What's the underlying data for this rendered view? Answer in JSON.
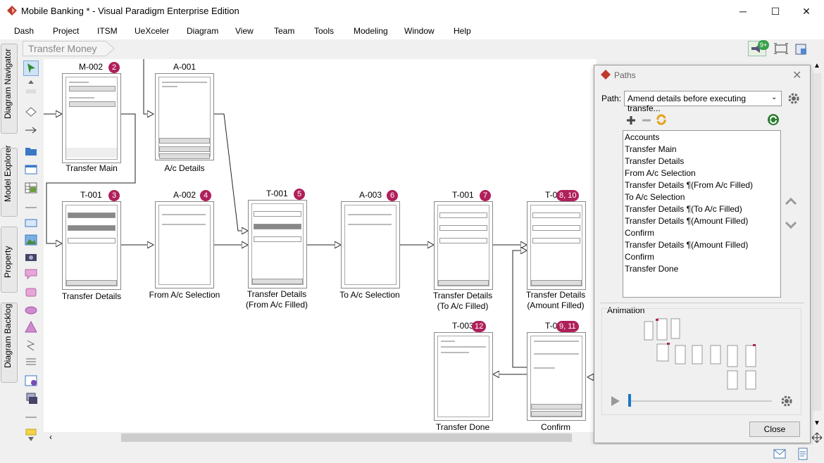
{
  "window": {
    "title": "Mobile Banking * - Visual Paradigm Enterprise Edition",
    "minimize_glyph": "─",
    "maximize_glyph": "☐",
    "close_glyph": "✕"
  },
  "menu": [
    "Dash",
    "Project",
    "ITSM",
    "UeXceler",
    "Diagram",
    "View",
    "Team",
    "Tools",
    "Modeling",
    "Window",
    "Help"
  ],
  "breadcrumb": "Transfer Money",
  "toolbar": {
    "notification_badge": "9+"
  },
  "left_tabs": [
    "Diagram Navigator",
    "Model Explorer",
    "Property",
    "Diagram Backlog"
  ],
  "screens": [
    {
      "id": "M-002",
      "badge": "2",
      "caption1": "Transfer Main",
      "caption2": ""
    },
    {
      "id": "A-001",
      "badge": "",
      "caption1": "A/c Details",
      "caption2": ""
    },
    {
      "id": "T-001",
      "badge": "3",
      "caption1": "Transfer Details",
      "caption2": ""
    },
    {
      "id": "A-002",
      "badge": "4",
      "caption1": "From A/c Selection",
      "caption2": ""
    },
    {
      "id": "T-001",
      "badge": "5",
      "caption1": "Transfer Details",
      "caption2": "(From A/c Filled)"
    },
    {
      "id": "A-003",
      "badge": "6",
      "caption1": "To A/c Selection",
      "caption2": ""
    },
    {
      "id": "T-001",
      "badge": "7",
      "caption1": "Transfer Details",
      "caption2": "(To A/c Filled)"
    },
    {
      "id": "T-0",
      "badge": "8, 10",
      "caption1": "Transfer Details",
      "caption2": "(Amount Filled)"
    },
    {
      "id": "T-003",
      "badge": "12",
      "caption1": "Transfer Done",
      "caption2": ""
    },
    {
      "id": "T-0",
      "badge": "9, 11",
      "caption1": "Confirm",
      "caption2": ""
    }
  ],
  "paths_panel": {
    "title": "Paths",
    "path_label": "Path:",
    "selected_path": "Amend details before executing transfe...",
    "items": [
      "Accounts",
      "Transfer Main",
      "Transfer Details",
      "From A/c Selection",
      "Transfer Details ¶(From A/c Filled)",
      "To A/c Selection",
      "Transfer Details ¶(To A/c Filled)",
      "Transfer Details ¶(Amount Filled)",
      "Confirm",
      "Transfer Details ¶(Amount Filled)",
      "Confirm",
      "Transfer Done"
    ],
    "animation_label": "Animation",
    "close_label": "Close",
    "add_icon": "plus-icon",
    "remove_icon": "minus-icon",
    "refresh_icon": "refresh-icon"
  },
  "colors": {
    "badge": "#b0205a",
    "accent": "#2e7d32",
    "app_red": "#c0392b"
  }
}
